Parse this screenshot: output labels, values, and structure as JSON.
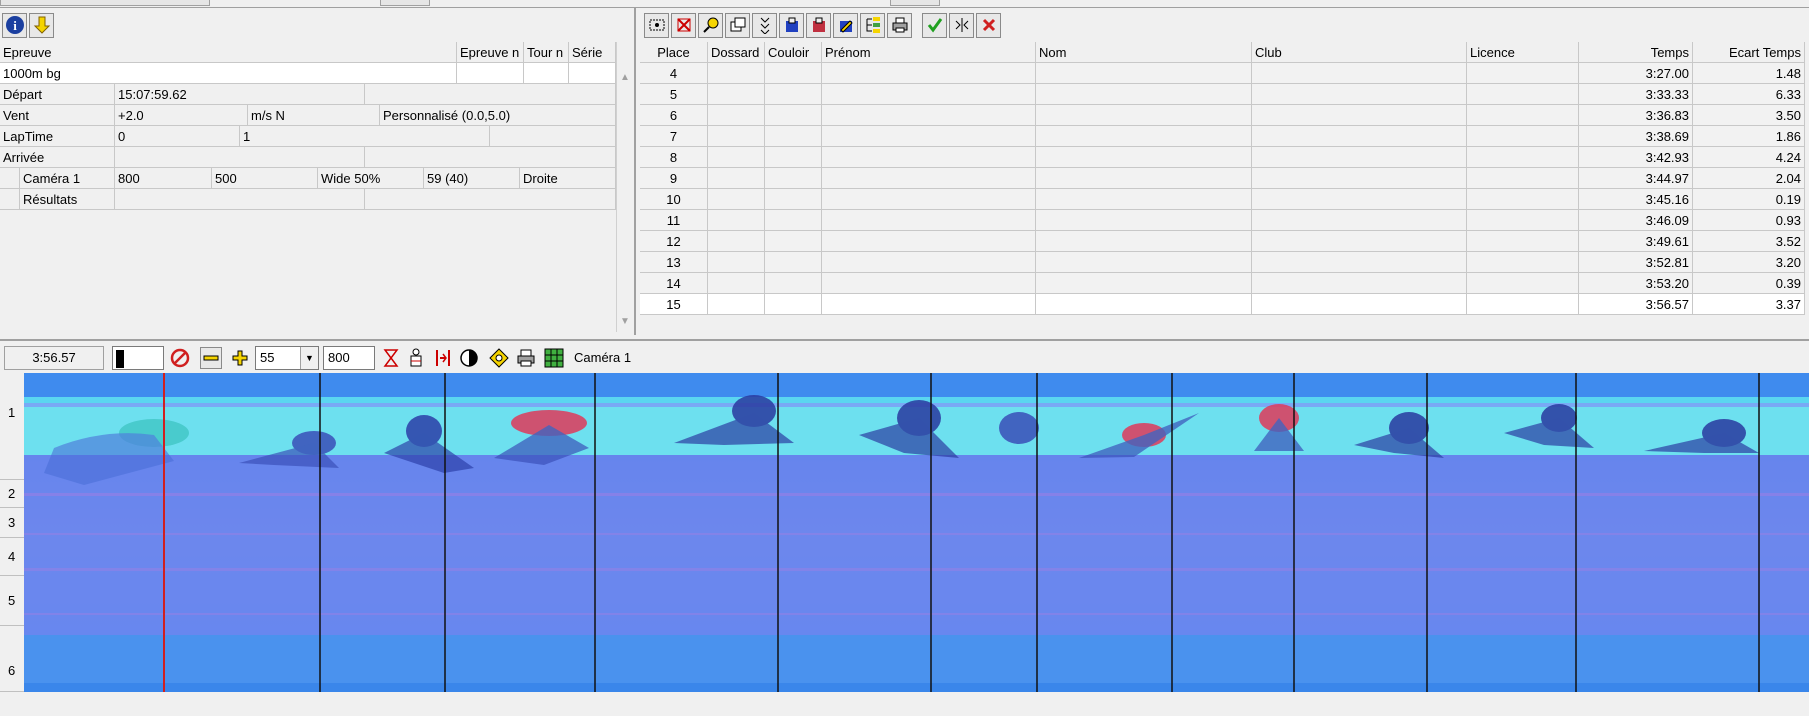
{
  "left_panel": {
    "toolbar": {
      "info_icon": "info-icon",
      "down_arrow_icon": "down-arrow-icon"
    },
    "headers": {
      "epreuve": "Epreuve",
      "epreuve_n": "Epreuve n",
      "tour_n": "Tour n",
      "serie": "Série"
    },
    "event_name": "1000m bg",
    "rows": {
      "depart_label": "Départ",
      "depart_value": "15:07:59.62",
      "vent_label": "Vent",
      "vent_value": "+2.0",
      "vent_unit": "m/s N",
      "vent_mode": "Personnalisé (0.0,5.0)",
      "laptime_label": "LapTime",
      "laptime_a": "0",
      "laptime_b": "1",
      "arrivee_label": "Arrivée",
      "camera_label": "Caméra 1",
      "camera_v1": "800",
      "camera_v2": "500",
      "camera_v3": "Wide 50%",
      "camera_v4": "59  (40)",
      "camera_v5": "Droite",
      "resultats_label": "Résultats"
    }
  },
  "right_panel": {
    "columns": {
      "place": "Place",
      "dossard": "Dossard",
      "couloir": "Couloir",
      "prenom": "Prénom",
      "nom": "Nom",
      "club": "Club",
      "licence": "Licence",
      "temps": "Temps",
      "ecart": "Ecart Temps"
    },
    "results": [
      {
        "place": "4",
        "temps": "3:27.00",
        "ecart": "1.48"
      },
      {
        "place": "5",
        "temps": "3:33.33",
        "ecart": "6.33"
      },
      {
        "place": "6",
        "temps": "3:36.83",
        "ecart": "3.50"
      },
      {
        "place": "7",
        "temps": "3:38.69",
        "ecart": "1.86"
      },
      {
        "place": "8",
        "temps": "3:42.93",
        "ecart": "4.24"
      },
      {
        "place": "9",
        "temps": "3:44.97",
        "ecart": "2.04"
      },
      {
        "place": "10",
        "temps": "3:45.16",
        "ecart": "0.19"
      },
      {
        "place": "11",
        "temps": "3:46.09",
        "ecart": "0.93"
      },
      {
        "place": "12",
        "temps": "3:49.61",
        "ecart": "3.52"
      },
      {
        "place": "13",
        "temps": "3:52.81",
        "ecart": "3.20"
      },
      {
        "place": "14",
        "temps": "3:53.20",
        "ecart": "0.39"
      },
      {
        "place": "15",
        "temps": "3:56.57",
        "ecart": "3.37"
      }
    ]
  },
  "lower_toolbar": {
    "current_time": "3:56.57",
    "zoom_value": "55",
    "width_value": "800",
    "camera": "Caméra 1"
  },
  "lanes": [
    "1",
    "2",
    "3",
    "4",
    "5",
    "6"
  ],
  "colors": {
    "image_bg": "#5a8fe6",
    "track_band": "#6fe3f0",
    "cursor": "#d02020"
  }
}
